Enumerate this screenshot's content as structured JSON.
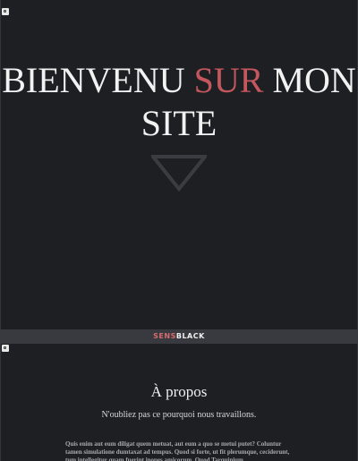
{
  "hero": {
    "title_part1": "BIENVENU",
    "title_accent": "SUR",
    "title_part2": "MON",
    "title_part3": "SITE",
    "scroll_icon": "down-triangle-icon"
  },
  "navbar": {
    "brand_part1": "SENS",
    "brand_part2": "BLACK"
  },
  "about": {
    "title": "À propos",
    "subtitle": "N'oubliez pas ce pourquoi nous travaillons.",
    "body": "Quis enim aut eum diligat quem metuat, aut eum a quo se metui putet? Coluntur tamen simulatione dumtaxat ad tempus. Quod si forte, ut fit plerumque, ceciderunt, tum intellegitur quam fuerint inopes amicorum. Quod Tarquinium"
  },
  "colors": {
    "background": "#1e1f23",
    "accent": "#c4575d",
    "navbar_bg": "#393a3f"
  }
}
